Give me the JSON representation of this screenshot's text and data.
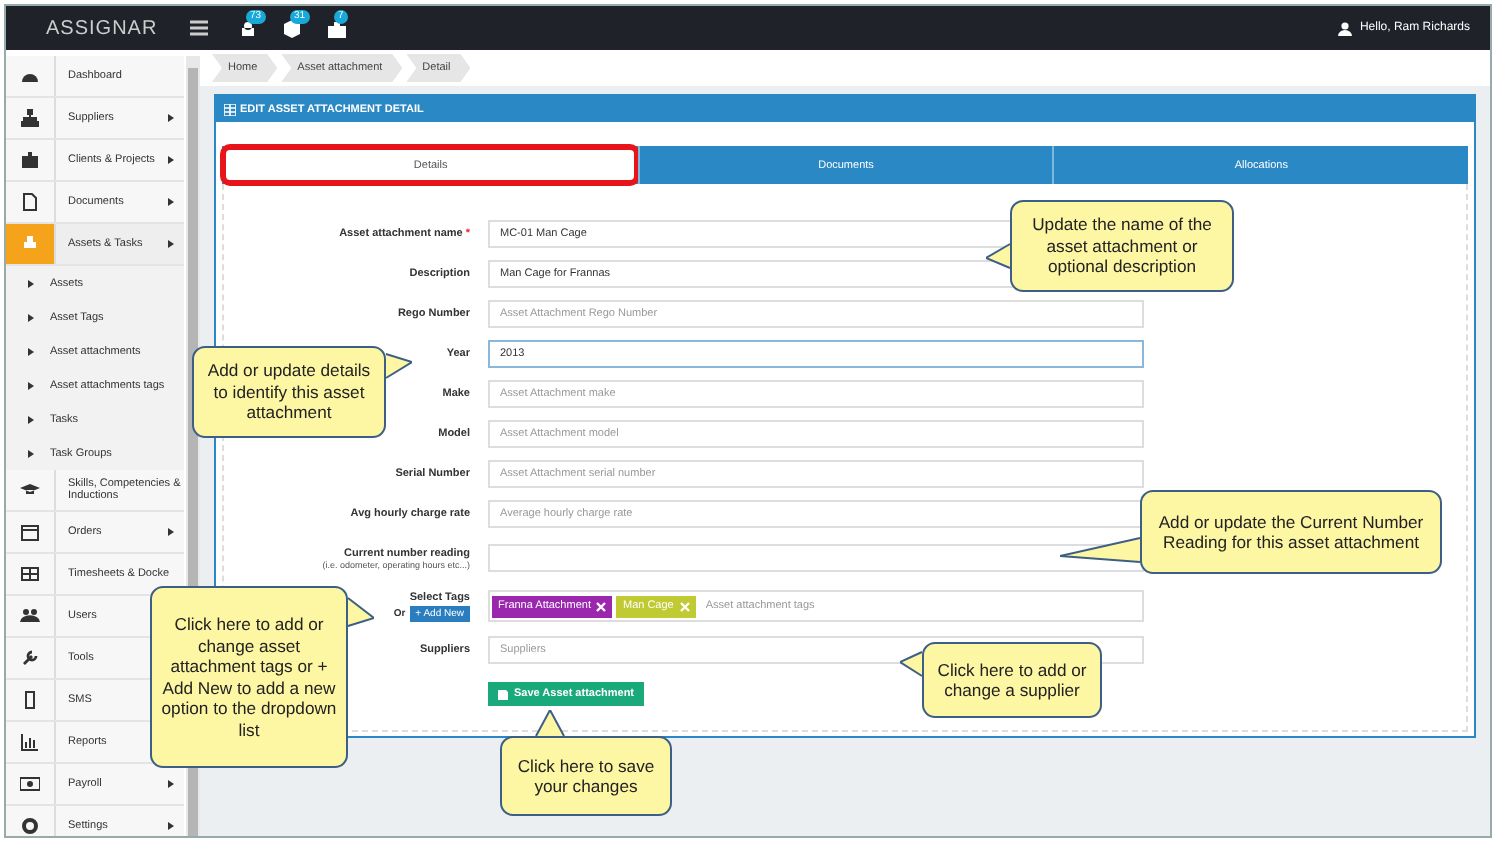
{
  "topbar": {
    "logo": "ASSIGNAR",
    "badges": [
      {
        "count": "73"
      },
      {
        "count": "31"
      },
      {
        "count": "7"
      }
    ],
    "greeting": "Hello, Ram Richards"
  },
  "sidebar": {
    "items": [
      {
        "label": "Dashboard",
        "has_submenu": false,
        "selected": false
      },
      {
        "label": "Suppliers",
        "has_submenu": true,
        "selected": false
      },
      {
        "label": "Clients & Projects",
        "has_submenu": true,
        "selected": false
      },
      {
        "label": "Documents",
        "has_submenu": true,
        "selected": false
      },
      {
        "label": "Assets & Tasks",
        "has_submenu": true,
        "selected": true,
        "children": [
          {
            "label": "Assets"
          },
          {
            "label": "Asset Tags"
          },
          {
            "label": "Asset attachments"
          },
          {
            "label": "Asset attachments tags"
          },
          {
            "label": "Tasks"
          },
          {
            "label": "Task Groups"
          }
        ]
      },
      {
        "label": "Skills, Competencies & Inductions",
        "has_submenu": false,
        "selected": false
      },
      {
        "label": "Orders",
        "has_submenu": true,
        "selected": false
      },
      {
        "label": "Timesheets & Docke",
        "has_submenu": false,
        "selected": false
      },
      {
        "label": "Users",
        "selected": false
      },
      {
        "label": "Tools",
        "selected": false
      },
      {
        "label": "SMS",
        "selected": false
      },
      {
        "label": "Reports",
        "selected": false
      },
      {
        "label": "Payroll",
        "has_submenu": true,
        "selected": false
      },
      {
        "label": "Settings",
        "has_submenu": true,
        "selected": false
      }
    ]
  },
  "breadcrumb": [
    "Home",
    "Asset attachment",
    "Detail"
  ],
  "panel": {
    "title": "EDIT ASSET ATTACHMENT DETAIL",
    "tabs": [
      {
        "label": "Details",
        "selected": true,
        "highlighted": true
      },
      {
        "label": "Documents",
        "selected": false,
        "highlighted": false
      },
      {
        "label": "Allocations",
        "selected": false,
        "highlighted": false
      }
    ],
    "fields": [
      {
        "kind": "text",
        "label": "Asset attachment name",
        "required_mark": "*",
        "value": "MC-01 Man Cage",
        "focused": false
      },
      {
        "kind": "text",
        "label": "Description",
        "value": "Man Cage for Frannas",
        "focused": false
      },
      {
        "kind": "text",
        "label": "Rego Number",
        "placeholder": "Asset Attachment Rego Number",
        "focused": false
      },
      {
        "kind": "text",
        "label": "Year",
        "value": "2013",
        "focused": true
      },
      {
        "kind": "text",
        "label": "Make",
        "placeholder": "Asset Attachment make",
        "focused": false
      },
      {
        "kind": "text",
        "label": "Model",
        "placeholder": "Asset Attachment model",
        "focused": false
      },
      {
        "kind": "text",
        "label": "Serial Number",
        "placeholder": "Asset Attachment serial number",
        "focused": false
      },
      {
        "kind": "text",
        "label": "Avg hourly charge rate",
        "placeholder": "Average hourly charge rate",
        "focused": false
      },
      {
        "kind": "text",
        "label": "Current number reading",
        "hint": "(i.e. odometer, operating hours etc...)",
        "focused": false
      },
      {
        "kind": "tags",
        "label": "Select Tags",
        "or_text": "Or",
        "add_button": "+ Add New",
        "tags": [
          {
            "label": "Franna Attachment",
            "color": "#9b27af"
          },
          {
            "label": "Man Cage",
            "color": "#c0ca33"
          }
        ],
        "placeholder": "Asset attachment tags"
      },
      {
        "kind": "text",
        "label": "Suppliers",
        "placeholder": "Suppliers",
        "focused": false
      }
    ],
    "save_button": "Save Asset attachment"
  },
  "callouts": [
    {
      "text": "Update the name of the asset attachment or optional description"
    },
    {
      "text": "Add or update details to identify this asset attachment"
    },
    {
      "text": "Add or update the Current Number Reading for this asset attachment"
    },
    {
      "text": "Click here to add or change asset attachment tags or + Add New to add a new option to the dropdown list"
    },
    {
      "text": "Click here to add or change a supplier"
    },
    {
      "text": "Click here to save your changes"
    }
  ]
}
